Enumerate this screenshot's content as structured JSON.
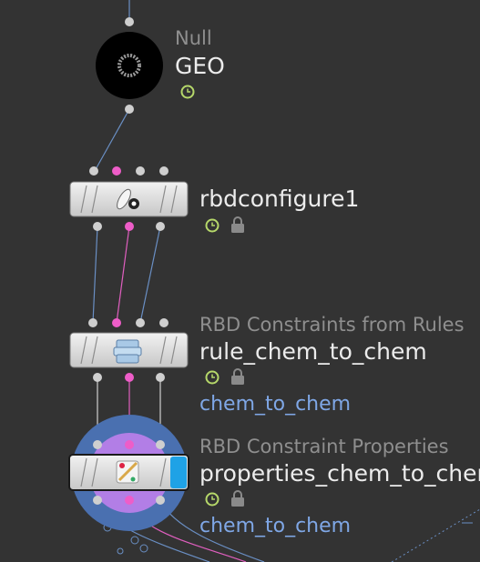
{
  "network": {
    "nodes": [
      {
        "type_label": "Null",
        "name": "GEO",
        "icon": "null-ring-icon",
        "flags": [
          "clock-icon"
        ]
      },
      {
        "type_label": "",
        "name": "rbdconfigure1",
        "icon": "bowling-pin-gear-icon",
        "flags": [
          "clock-icon",
          "lock-icon"
        ]
      },
      {
        "type_label": "RBD Constraints from Rules",
        "name": "rule_chem_to_chem",
        "group": "chem_to_chem",
        "icon": "constraint-stack-icon",
        "flags": [
          "clock-icon",
          "lock-icon"
        ]
      },
      {
        "type_label": "RBD Constraint Properties",
        "name": "properties_chem_to_chem",
        "group": "chem_to_chem",
        "icon": "constraint-properties-icon",
        "flags": [
          "clock-icon",
          "lock-icon"
        ],
        "selected": true,
        "display_flag": true
      }
    ]
  },
  "colors": {
    "background": "#333333",
    "wire_blue": "#6a8fc4",
    "wire_pink": "#e05fbf",
    "wire_white": "#d0d0d0",
    "port_pink": "#ee5dc8",
    "flag_green": "#b6d86a",
    "display_blue": "#1fa2e6",
    "halo_blue": "#4a70b0",
    "halo_purple": "#b27ee6"
  }
}
